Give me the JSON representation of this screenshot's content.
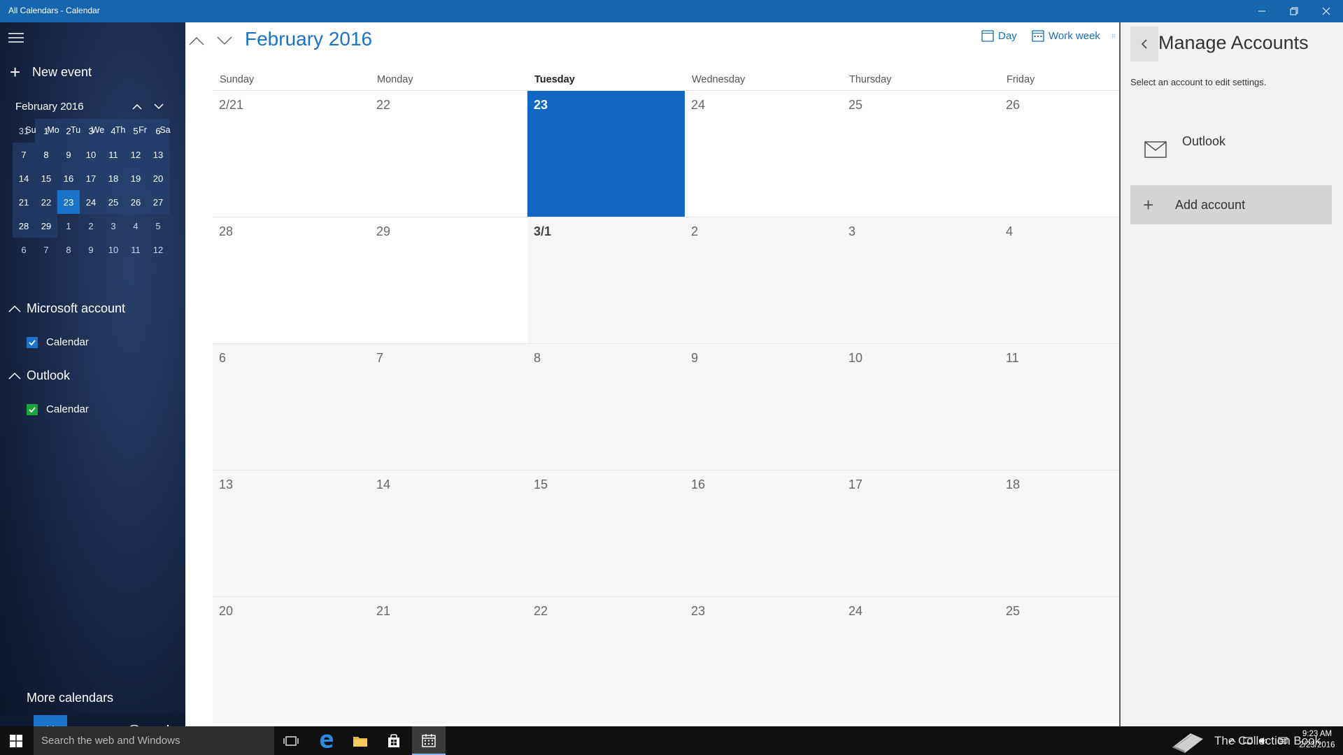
{
  "window": {
    "title": "All Calendars - Calendar",
    "controls": [
      "minimize-icon",
      "restore-icon",
      "close-icon"
    ]
  },
  "sidebar": {
    "new_event_label": "New event",
    "mini_calendar": {
      "title": "February 2016",
      "weekdays": [
        "Su",
        "Mo",
        "Tu",
        "We",
        "Th",
        "Fr",
        "Sa"
      ],
      "weeks": [
        [
          "31",
          "1",
          "2",
          "3",
          "4",
          "5",
          "6"
        ],
        [
          "7",
          "8",
          "9",
          "10",
          "11",
          "12",
          "13"
        ],
        [
          "14",
          "15",
          "16",
          "17",
          "18",
          "19",
          "20"
        ],
        [
          "21",
          "22",
          "23",
          "24",
          "25",
          "26",
          "27"
        ],
        [
          "28",
          "29",
          "1",
          "2",
          "3",
          "4",
          "5"
        ],
        [
          "6",
          "7",
          "8",
          "9",
          "10",
          "11",
          "12"
        ]
      ],
      "selected": "23"
    },
    "accounts": [
      {
        "name": "Microsoft account",
        "calendar_label": "Calendar",
        "checkbox_color": "#1a73c9"
      },
      {
        "name": "Outlook",
        "calendar_label": "Calendar",
        "checkbox_color": "#19a33a"
      }
    ],
    "more_calendars_label": "More calendars",
    "bottom_icons": [
      "mail-icon",
      "calendar-icon",
      "smiley-icon",
      "gear-icon"
    ]
  },
  "main": {
    "month_title": "February 2016",
    "views": [
      {
        "label": "Day",
        "icon": "day-view-icon"
      },
      {
        "label": "Work week",
        "icon": "work-week-icon"
      }
    ],
    "weekdays": [
      "Sunday",
      "Monday",
      "Tuesday",
      "Wednesday",
      "Thursday",
      "Friday"
    ],
    "today_column": 2,
    "weeks": [
      [
        "2/21",
        "22",
        "23",
        "24",
        "25",
        "26"
      ],
      [
        "28",
        "29",
        "3/1",
        "2",
        "3",
        "4"
      ],
      [
        "6",
        "7",
        "8",
        "9",
        "10",
        "11"
      ],
      [
        "13",
        "14",
        "15",
        "16",
        "17",
        "18"
      ],
      [
        "20",
        "21",
        "22",
        "23",
        "24",
        "25"
      ]
    ],
    "accent_color": "#1a73c9"
  },
  "manage_accounts": {
    "title": "Manage Accounts",
    "subtitle": "Select an account to edit settings.",
    "account_name": "Outlook",
    "add_account_label": "Add account"
  },
  "taskbar": {
    "search_placeholder": "Search the web and Windows",
    "brand_text": "The Collection Book",
    "clock_time": "9:23 AM",
    "clock_date": "2/23/2016"
  }
}
